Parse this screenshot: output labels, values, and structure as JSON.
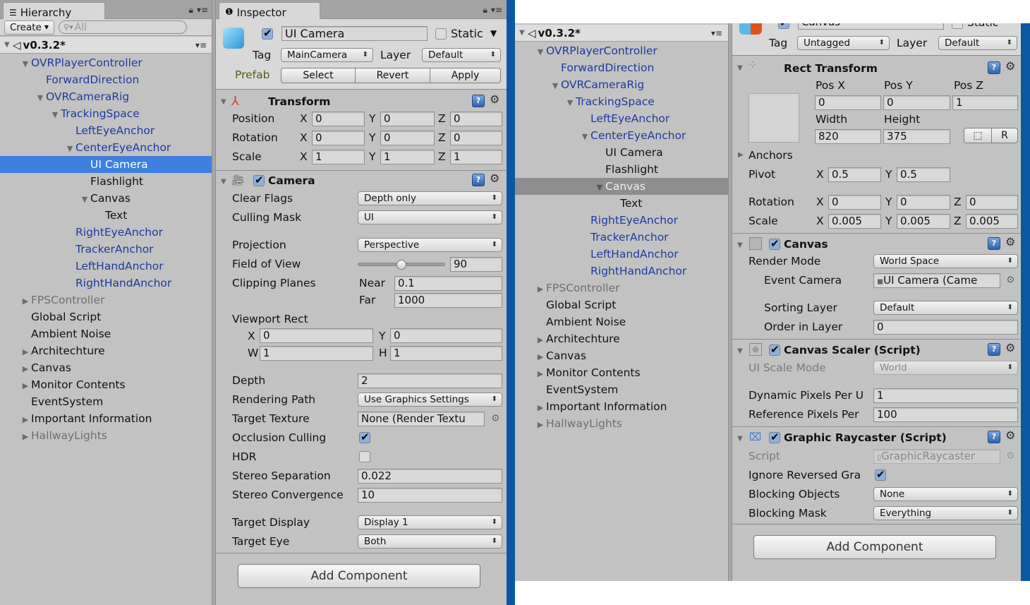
{
  "left": {
    "hierarchy": {
      "tab_label": "Hierarchy",
      "create_label": "Create",
      "search_placeholder": "All",
      "scene_name": "v0.3.2*",
      "nodes": [
        {
          "label": "OVRPlayerController",
          "depth": 1,
          "arrow": "expanded",
          "style": "prefab"
        },
        {
          "label": "ForwardDirection",
          "depth": 2,
          "arrow": "none",
          "style": "prefab"
        },
        {
          "label": "OVRCameraRig",
          "depth": 2,
          "arrow": "expanded",
          "style": "prefab"
        },
        {
          "label": "TrackingSpace",
          "depth": 3,
          "arrow": "expanded",
          "style": "prefab"
        },
        {
          "label": "LeftEyeAnchor",
          "depth": 4,
          "arrow": "none",
          "style": "prefab"
        },
        {
          "label": "CenterEyeAnchor",
          "depth": 4,
          "arrow": "expanded",
          "style": "prefab"
        },
        {
          "label": "UI Camera",
          "depth": 5,
          "arrow": "none",
          "style": "selected"
        },
        {
          "label": "Flashlight",
          "depth": 5,
          "arrow": "none",
          "style": "normal"
        },
        {
          "label": "Canvas",
          "depth": 5,
          "arrow": "expanded",
          "style": "normal"
        },
        {
          "label": "Text",
          "depth": 6,
          "arrow": "none",
          "style": "normal"
        },
        {
          "label": "RightEyeAnchor",
          "depth": 4,
          "arrow": "none",
          "style": "prefab"
        },
        {
          "label": "TrackerAnchor",
          "depth": 4,
          "arrow": "none",
          "style": "prefab"
        },
        {
          "label": "LeftHandAnchor",
          "depth": 4,
          "arrow": "none",
          "style": "prefab"
        },
        {
          "label": "RightHandAnchor",
          "depth": 4,
          "arrow": "none",
          "style": "prefab"
        },
        {
          "label": "FPSController",
          "depth": 1,
          "arrow": "collapsed",
          "style": "dim"
        },
        {
          "label": "Global Script",
          "depth": 1,
          "arrow": "none",
          "style": "normal"
        },
        {
          "label": "Ambient Noise",
          "depth": 1,
          "arrow": "none",
          "style": "normal"
        },
        {
          "label": "Architechture",
          "depth": 1,
          "arrow": "collapsed",
          "style": "normal"
        },
        {
          "label": "Canvas",
          "depth": 1,
          "arrow": "collapsed",
          "style": "normal"
        },
        {
          "label": "Monitor Contents",
          "depth": 1,
          "arrow": "collapsed",
          "style": "normal"
        },
        {
          "label": "EventSystem",
          "depth": 1,
          "arrow": "none",
          "style": "normal"
        },
        {
          "label": "Important Information",
          "depth": 1,
          "arrow": "collapsed",
          "style": "normal"
        },
        {
          "label": "HallwayLights",
          "depth": 1,
          "arrow": "collapsed",
          "style": "dim"
        }
      ]
    },
    "inspector": {
      "tab_label": "Inspector",
      "object_name": "UI Camera",
      "active": true,
      "static_label": "Static",
      "static": false,
      "tag_label": "Tag",
      "tag_value": "MainCamera",
      "layer_label": "Layer",
      "layer_value": "Default",
      "prefab_label": "Prefab",
      "prefab_buttons": [
        "Select",
        "Revert",
        "Apply"
      ],
      "transform": {
        "title": "Transform",
        "rows": [
          {
            "label": "Position",
            "x": "0",
            "y": "0",
            "z": "0"
          },
          {
            "label": "Rotation",
            "x": "0",
            "y": "0",
            "z": "0"
          },
          {
            "label": "Scale",
            "x": "1",
            "y": "1",
            "z": "1"
          }
        ]
      },
      "camera": {
        "title": "Camera",
        "enabled": true,
        "clear_flags_label": "Clear Flags",
        "clear_flags": "Depth only",
        "culling_mask_label": "Culling Mask",
        "culling_mask": "UI",
        "projection_label": "Projection",
        "projection": "Perspective",
        "fov_label": "Field of View",
        "fov": "90",
        "fov_fraction": 0.5,
        "clipping_label": "Clipping Planes",
        "near_label": "Near",
        "near": "0.1",
        "far_label": "Far",
        "far": "1000",
        "viewport_label": "Viewport Rect",
        "vp_x": "0",
        "vp_y": "0",
        "vp_w": "1",
        "vp_h": "1",
        "depth_label": "Depth",
        "depth": "2",
        "rendering_path_label": "Rendering Path",
        "rendering_path": "Use Graphics Settings",
        "target_texture_label": "Target Texture",
        "target_texture": "None (Render Textu",
        "occlusion_label": "Occlusion Culling",
        "occlusion": true,
        "hdr_label": "HDR",
        "hdr": false,
        "stereo_sep_label": "Stereo Separation",
        "stereo_sep": "0.022",
        "stereo_conv_label": "Stereo Convergence",
        "stereo_conv": "10",
        "target_display_label": "Target Display",
        "target_display": "Display 1",
        "target_eye_label": "Target Eye",
        "target_eye": "Both"
      },
      "add_component": "Add Component"
    }
  },
  "right": {
    "hierarchy": {
      "scene_name": "v0.3.2*",
      "nodes": [
        {
          "label": "OVRPlayerController",
          "depth": 1,
          "arrow": "expanded",
          "style": "prefab"
        },
        {
          "label": "ForwardDirection",
          "depth": 2,
          "arrow": "none",
          "style": "prefab"
        },
        {
          "label": "OVRCameraRig",
          "depth": 2,
          "arrow": "expanded",
          "style": "prefab"
        },
        {
          "label": "TrackingSpace",
          "depth": 3,
          "arrow": "expanded",
          "style": "prefab"
        },
        {
          "label": "LeftEyeAnchor",
          "depth": 4,
          "arrow": "none",
          "style": "prefab"
        },
        {
          "label": "CenterEyeAnchor",
          "depth": 4,
          "arrow": "expanded",
          "style": "prefab"
        },
        {
          "label": "UI Camera",
          "depth": 5,
          "arrow": "none",
          "style": "normal"
        },
        {
          "label": "Flashlight",
          "depth": 5,
          "arrow": "none",
          "style": "normal"
        },
        {
          "label": "Canvas",
          "depth": 5,
          "arrow": "expanded",
          "style": "selected-gray"
        },
        {
          "label": "Text",
          "depth": 6,
          "arrow": "none",
          "style": "normal"
        },
        {
          "label": "RightEyeAnchor",
          "depth": 4,
          "arrow": "none",
          "style": "prefab"
        },
        {
          "label": "TrackerAnchor",
          "depth": 4,
          "arrow": "none",
          "style": "prefab"
        },
        {
          "label": "LeftHandAnchor",
          "depth": 4,
          "arrow": "none",
          "style": "prefab"
        },
        {
          "label": "RightHandAnchor",
          "depth": 4,
          "arrow": "none",
          "style": "prefab"
        },
        {
          "label": "FPSController",
          "depth": 1,
          "arrow": "collapsed",
          "style": "dim"
        },
        {
          "label": "Global Script",
          "depth": 1,
          "arrow": "none",
          "style": "normal"
        },
        {
          "label": "Ambient Noise",
          "depth": 1,
          "arrow": "none",
          "style": "normal"
        },
        {
          "label": "Architechture",
          "depth": 1,
          "arrow": "collapsed",
          "style": "normal"
        },
        {
          "label": "Canvas",
          "depth": 1,
          "arrow": "collapsed",
          "style": "normal"
        },
        {
          "label": "Monitor Contents",
          "depth": 1,
          "arrow": "collapsed",
          "style": "normal"
        },
        {
          "label": "EventSystem",
          "depth": 1,
          "arrow": "none",
          "style": "normal"
        },
        {
          "label": "Important Information",
          "depth": 1,
          "arrow": "collapsed",
          "style": "normal"
        },
        {
          "label": "HallwayLights",
          "depth": 1,
          "arrow": "collapsed",
          "style": "dim"
        }
      ]
    },
    "inspector": {
      "object_name": "Canvas",
      "static_label": "Static",
      "tag_label": "Tag",
      "tag_value": "Untagged",
      "layer_label": "Layer",
      "layer_value": "Default",
      "rect_transform": {
        "title": "Rect Transform",
        "pos_x_label": "Pos X",
        "pos_y_label": "Pos Y",
        "pos_z_label": "Pos Z",
        "pos_x": "0",
        "pos_y": "0",
        "pos_z": "1",
        "width_label": "Width",
        "height_label": "Height",
        "width": "820",
        "height": "375",
        "r_button": "R",
        "anchors_label": "Anchors",
        "pivot_label": "Pivot",
        "pivot_x": "0.5",
        "pivot_y": "0.5",
        "rotation_label": "Rotation",
        "rot_x": "0",
        "rot_y": "0",
        "rot_z": "0",
        "scale_label": "Scale",
        "scale_x": "0.005",
        "scale_y": "0.005",
        "scale_z": "0.005"
      },
      "canvas": {
        "title": "Canvas",
        "enabled": true,
        "render_mode_label": "Render Mode",
        "render_mode": "World Space",
        "event_camera_label": "Event Camera",
        "event_camera": "UI Camera (Came",
        "sorting_layer_label": "Sorting Layer",
        "sorting_layer": "Default",
        "order_label": "Order in Layer",
        "order": "0"
      },
      "canvas_scaler": {
        "title": "Canvas Scaler (Script)",
        "enabled": true,
        "ui_scale_mode_label": "UI Scale Mode",
        "ui_scale_mode": "World",
        "dynamic_label": "Dynamic Pixels Per U",
        "dynamic": "1",
        "reference_label": "Reference Pixels Per",
        "reference": "100"
      },
      "graphic_raycaster": {
        "title": "Graphic Raycaster (Script)",
        "enabled": true,
        "script_label": "Script",
        "script": "GraphicRaycaster",
        "ignore_label": "Ignore Reversed Gra",
        "ignore": true,
        "blocking_objects_label": "Blocking Objects",
        "blocking_objects": "None",
        "blocking_mask_label": "Blocking Mask",
        "blocking_mask": "Everything"
      },
      "add_component": "Add Component"
    }
  },
  "icons": {
    "hierarchy": "list-icon",
    "inspector": "info-icon",
    "lock": "lock-icon",
    "menu": "menu-icon",
    "help": "help-icon",
    "gear": "gear-icon"
  }
}
